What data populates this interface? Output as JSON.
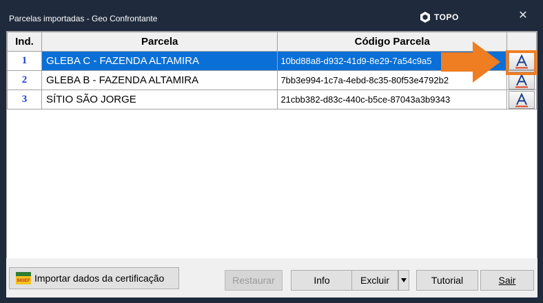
{
  "window": {
    "title": "Parcelas importadas - Geo Confrontante",
    "brand": "TOPO",
    "close_glyph": "✕"
  },
  "grid": {
    "headers": {
      "ind": "Ind.",
      "parcela": "Parcela",
      "codigo": "Código Parcela"
    },
    "rows": [
      {
        "ind": "1",
        "parcela": "GLEBA C - FAZENDA ALTAMIRA",
        "codigo": "10bd88a8-d932-41d9-8e29-7a54c9a5",
        "action_icon": "A",
        "selected": true
      },
      {
        "ind": "2",
        "parcela": "GLEBA B - FAZENDA ALTAMIRA",
        "codigo": "7bb3e994-1c7a-4ebd-8c35-80f53e4792b2",
        "action_icon": "A",
        "selected": false
      },
      {
        "ind": "3",
        "parcela": "SÍTIO SÃO JORGE",
        "codigo": "21cbb382-d83c-440c-b5ce-87043a3b9343",
        "action_icon": "A",
        "selected": false
      }
    ]
  },
  "buttons": {
    "importar": "Importar dados da certificação",
    "importar_icon_text": "SIGEF",
    "restaurar": "Restaurar",
    "info": "Info",
    "excluir": "Excluir",
    "tutorial": "Tutorial",
    "sair": "Sair"
  },
  "colors": {
    "titlebar": "#1f2b3d",
    "selection": "#0a6fd6",
    "highlight": "#ef7d22",
    "index_text": "#1a3fd1"
  }
}
